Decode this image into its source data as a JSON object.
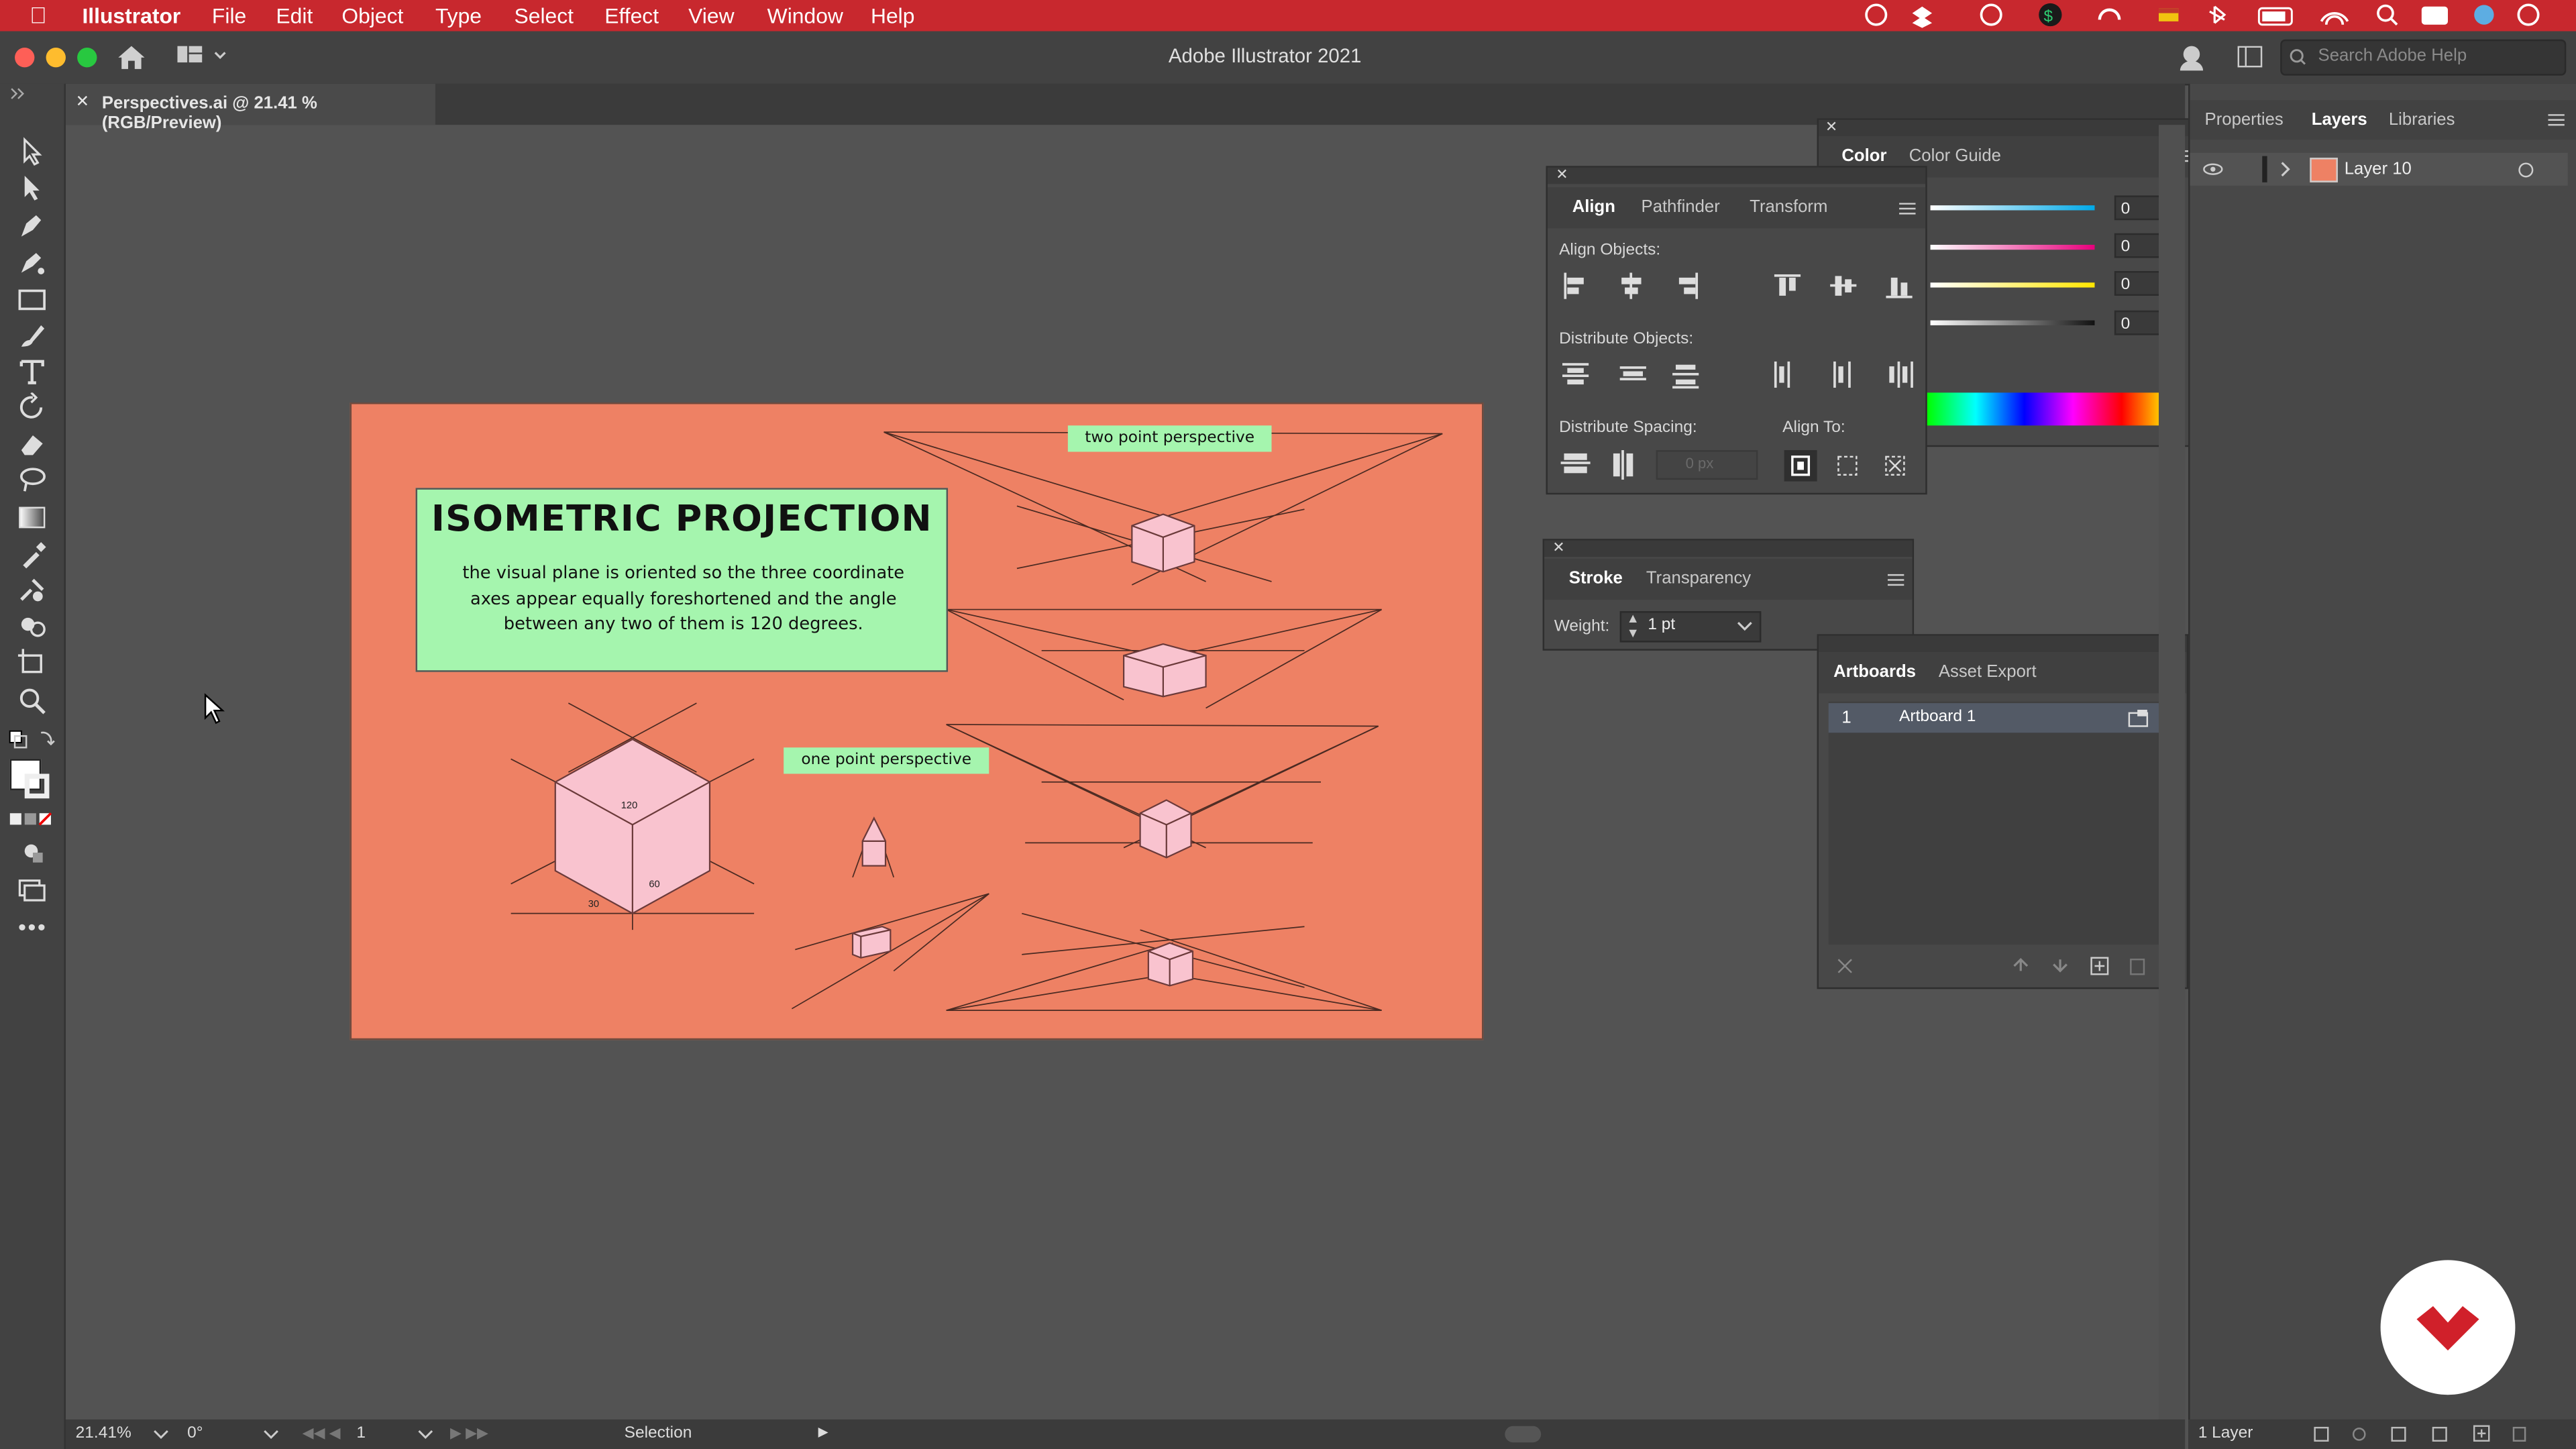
{
  "menubar": {
    "app_name": "Illustrator",
    "items": [
      "File",
      "Edit",
      "Object",
      "Type",
      "Select",
      "Effect",
      "View",
      "Window",
      "Help"
    ]
  },
  "window": {
    "title": "Adobe Illustrator 2021",
    "search_placeholder": "Search Adobe Help"
  },
  "document_tab": {
    "label": "Perspectives.ai @ 21.41 % (RGB/Preview)"
  },
  "artboard_content": {
    "iso_title": "ISOMETRIC PROJECTION",
    "iso_description": "the visual plane is oriented so the three coordinate axes appear equally foreshortened and the angle between any two of them is 120 degrees.",
    "two_point_label": "two point perspective",
    "one_point_label": "one point perspective",
    "angle_120": "120",
    "angle_60": "60",
    "angle_30": "30"
  },
  "color_panel": {
    "tabs": [
      "Color",
      "Color Guide"
    ],
    "values": [
      "0",
      "0",
      "0",
      "0"
    ],
    "unit": "%"
  },
  "align_panel": {
    "tabs": [
      "Align",
      "Pathfinder",
      "Transform"
    ],
    "align_objects_label": "Align Objects:",
    "distribute_objects_label": "Distribute Objects:",
    "distribute_spacing_label": "Distribute Spacing:",
    "align_to_label": "Align To:",
    "spacing_value": "0 px"
  },
  "stroke_panel": {
    "tabs": [
      "Stroke",
      "Transparency"
    ],
    "weight_label": "Weight:",
    "weight_value": "1 pt"
  },
  "right_panel": {
    "tabs": [
      "Properties",
      "Layers",
      "Libraries"
    ],
    "layer_name": "Layer 10",
    "layer_count": "1 Layer"
  },
  "artboards_panel": {
    "tabs": [
      "Artboards",
      "Asset Export"
    ],
    "rows": [
      {
        "index": "1",
        "name": "Artboard 1"
      }
    ]
  },
  "statusbar": {
    "zoom": "21.41%",
    "rotation": "0°",
    "artboard_number": "1",
    "tool": "Selection"
  },
  "colors": {
    "menubar": "#c8282e",
    "artboard": "#ee8164",
    "label_green": "#a5f5ae",
    "cube_pink": "#f9c3cf"
  }
}
